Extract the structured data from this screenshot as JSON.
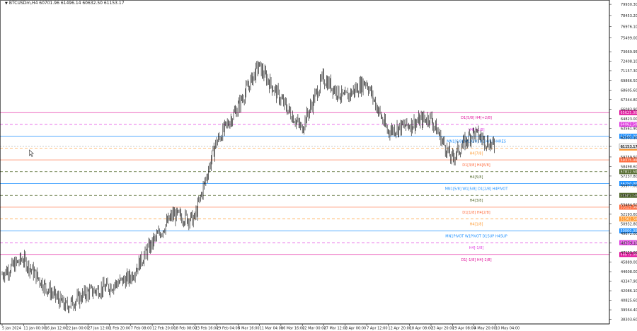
{
  "header": {
    "symbol_line": "BTCUSDm,H4  60701.96 61496.14 60632.50 61153.17"
  },
  "price_axis": {
    "ticks": [
      "79930.30",
      "78453.20",
      "76976.10",
      "75499.00",
      "73669.95",
      "72408.10",
      "71157.30",
      "69866.50",
      "68605.60",
      "67344.80",
      "66083.90",
      "64823.00",
      "63561.90",
      "62301.10",
      "61153.17",
      "59759.50",
      "58498.60",
      "57237.80",
      "55977.00",
      "54697.50",
      "53464.50",
      "52193.60",
      "50932.80",
      "49672.00",
      "48379.10",
      "47150.00",
      "45889.00",
      "44608.00",
      "43347.90",
      "42086.10",
      "40825.60",
      "39564.40",
      "38303.60"
    ],
    "current_price": "61153.17"
  },
  "time_axis": {
    "labels": [
      "5 Jan 2024",
      "11 Jan 00:00",
      "16 Jan 12:00",
      "22 Jan 00:00",
      "27 Jan 12:00",
      "1 Feb 20:00",
      "7 Feb 08:00",
      "12 Feb 20:00",
      "18 Feb 08:00",
      "23 Feb 16:00",
      "29 Feb 04:00",
      "5 Mar 16:00",
      "11 Mar 04:00",
      "16 Mar 16:00",
      "22 Mar 00:00",
      "27 Mar 12:00",
      "2 Apr 00:00",
      "7 Apr 12:00",
      "12 Apr 20:00",
      "18 Apr 08:00",
      "23 Apr 20:00",
      "29 Apr 08:00",
      "4 May 20:00",
      "10 May 04:00"
    ]
  },
  "levels": [
    {
      "label": "D1[5/8] H4[+2/8]",
      "price_tag": "65625.00",
      "color": "#e0109a",
      "dashed": false
    },
    {
      "label": "H4[+1/8]",
      "price_tag": "64062.50",
      "color": "#e040e0",
      "dashed": true
    },
    {
      "label": "MN1[6/8] W1[6/8] D1[4/8] H4RES",
      "price_tag": "62500.00",
      "color": "#1e90ff",
      "dashed": false
    },
    {
      "label": "H4[7/8]",
      "price_tag": "60937.50",
      "color": "#ff9a30",
      "dashed": true
    },
    {
      "label": "D1[3/8] H4[6/8]",
      "price_tag": "59375.00",
      "color": "#ff6a3c",
      "dashed": false
    },
    {
      "label": "H4[5/8]",
      "price_tag": "57812.50",
      "color": "#556b2f",
      "dashed": true
    },
    {
      "label": "MN1[5/8] W1[5/8] D1[2/8] H4PIVOT",
      "price_tag": "56250.00",
      "color": "#1e90ff",
      "dashed": false
    },
    {
      "label": "H4[3/8]",
      "price_tag": "54687.50",
      "color": "#556b2f",
      "dashed": true
    },
    {
      "label": "D1[1/8] H4[2/8]",
      "price_tag": "53125.00",
      "color": "#ff6a3c",
      "dashed": false
    },
    {
      "label": "H4[1/8]",
      "price_tag": "51562.50",
      "color": "#ff9a30",
      "dashed": true
    },
    {
      "label": "MN1PIVOT W1PIVOT D1SUP H4SUP",
      "price_tag": "50000.00",
      "color": "#1e90ff",
      "dashed": false
    },
    {
      "label": "H4[-1/8]",
      "price_tag": "48437.50",
      "color": "#e040e0",
      "dashed": true
    },
    {
      "label": "D1[-1/8] H4[-2/8]",
      "price_tag": "46875.00",
      "color": "#e0109a",
      "dashed": false
    }
  ],
  "chart_data": {
    "type": "line",
    "title": "BTCUSDm,H4",
    "xlabel": "",
    "ylabel": "",
    "ylim": [
      37700,
      80500
    ],
    "x": [
      "5 Jan 2024",
      "11 Jan 00:00",
      "16 Jan 12:00",
      "22 Jan 00:00",
      "27 Jan 12:00",
      "1 Feb 20:00",
      "7 Feb 08:00",
      "12 Feb 20:00",
      "18 Feb 08:00",
      "23 Feb 16:00",
      "29 Feb 04:00",
      "5 Mar 16:00",
      "11 Mar 04:00",
      "16 Mar 16:00",
      "22 Mar 00:00",
      "27 Mar 12:00",
      "2 Apr 00:00",
      "7 Apr 12:00",
      "12 Apr 20:00",
      "18 Apr 08:00",
      "23 Apr 20:00",
      "29 Apr 08:00",
      "4 May 20:00",
      "10 May 04:00"
    ],
    "series": [
      {
        "values": [
          44200,
          46300,
          42800,
          40000,
          41800,
          42600,
          43800,
          48200,
          52100,
          51500,
          61500,
          66200,
          71800,
          67500,
          63500,
          70200,
          67500,
          69800,
          63200,
          64000,
          65000,
          59500,
          63000,
          61153
        ]
      }
    ],
    "grid": false
  }
}
